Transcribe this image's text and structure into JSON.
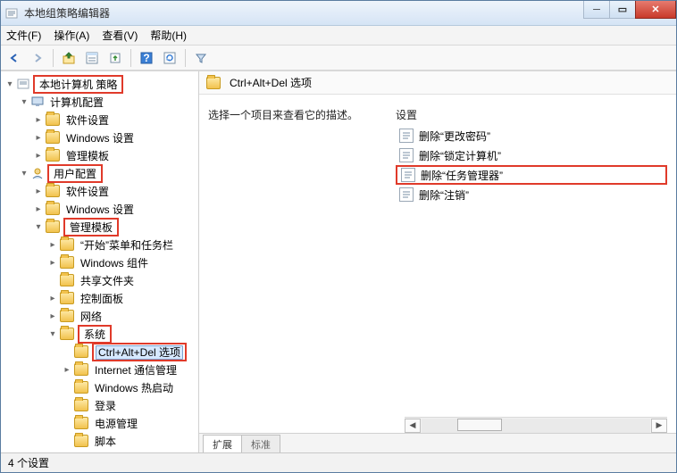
{
  "window": {
    "title": "本地组策略编辑器"
  },
  "menu": {
    "file": "文件(F)",
    "action": "操作(A)",
    "view": "查看(V)",
    "help": "帮助(H)"
  },
  "toolbar_icons": [
    "back",
    "forward",
    "up",
    "show-hide",
    "export",
    "help1",
    "help2",
    "filter"
  ],
  "tree": {
    "root": "本地计算机 策略",
    "computer_config": "计算机配置",
    "cc_software": "软件设置",
    "cc_windows": "Windows 设置",
    "cc_admin": "管理模板",
    "user_config": "用户配置",
    "uc_software": "软件设置",
    "uc_windows": "Windows 设置",
    "uc_admin": "管理模板",
    "start_taskbar": "“开始”菜单和任务栏",
    "win_components": "Windows 组件",
    "shared_folders": "共享文件夹",
    "control_panel": "控制面板",
    "network": "网络",
    "system": "系统",
    "cad": "Ctrl+Alt+Del 选项",
    "internet_comm": "Internet 通信管理",
    "win_hotstart": "Windows 热启动",
    "login": "登录",
    "power": "电源管理",
    "scripts": "脚本"
  },
  "right": {
    "header": "Ctrl+Alt+Del 选项",
    "desc": "选择一个项目来查看它的描述。",
    "col_settings": "设置",
    "items": {
      "change_pw": "删除“更改密码”",
      "lock": "删除“锁定计算机”",
      "taskmgr": "删除“任务管理器”",
      "logoff": "删除“注销”"
    },
    "tab_ext": "扩展",
    "tab_std": "标准"
  },
  "status": {
    "text": "4 个设置"
  }
}
